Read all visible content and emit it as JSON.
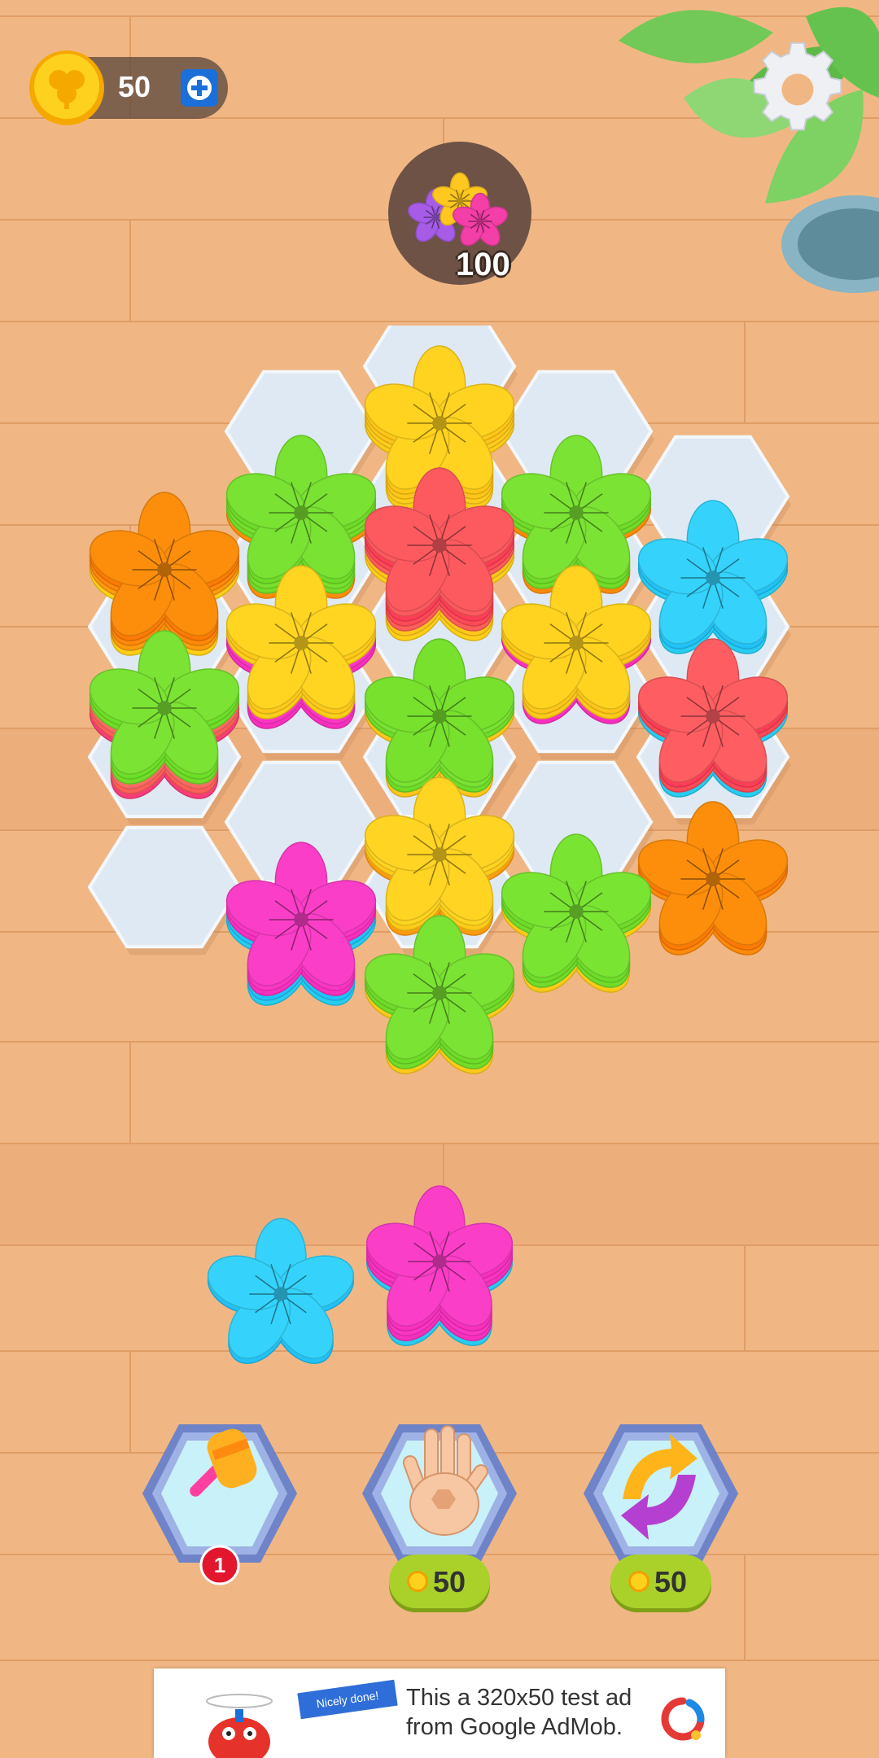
{
  "currency": {
    "coins": "50",
    "add_icon": "plus-icon",
    "coin_icon": "clover-coin-icon"
  },
  "settings": {
    "icon": "gear-icon"
  },
  "goal": {
    "count": "100",
    "icon": "flower-bundle-icon"
  },
  "board": {
    "empty_cells": [
      "1-2",
      "2-2",
      "0-3",
      "3-2"
    ],
    "stacks": [
      {
        "cell": "0-1",
        "layers": [
          "#fed019",
          "#fe9c0e",
          "#fe8a0a",
          "#fd7a05"
        ],
        "top": "#fd8e0b"
      },
      {
        "cell": "0-2",
        "layers": [
          "#fa3d7a",
          "#fe5f59",
          "#fd6a63",
          "#71dd2a",
          "#6ce027"
        ],
        "top": "#7be333"
      },
      {
        "cell": "1-0",
        "layers": [
          "#fecb19",
          "#fdcd1c",
          "#fec61a",
          "#ffc618"
        ],
        "top": "#ffd31f"
      },
      {
        "cell": "1-1",
        "layers": [
          "#fd8e0b",
          "#71dd2a",
          "#76e02d",
          "#6ddb27"
        ],
        "top": "#79e232"
      },
      {
        "cell": "1-1b",
        "layers": [
          "#f92fbf",
          "#fb35c4",
          "#fed019",
          "#fec91a"
        ],
        "top": "#ffd521"
      },
      {
        "cell": "1-3",
        "layers": [
          "#27cdf0",
          "#fe3d56",
          "#fe5960",
          "#fd4a57"
        ],
        "top": "#fe5e62"
      },
      {
        "cell": "2-0",
        "layers": [
          "#fed019",
          "#fec61a",
          "#fe5f59",
          "#fd4a57",
          "#fe3d56",
          "#fd5a5e"
        ],
        "top": "#fd5a60"
      },
      {
        "cell": "2-1",
        "layers": [
          "#fec61a",
          "#6edc28",
          "#79e232"
        ],
        "top": "#77e12e"
      },
      {
        "cell": "2-2",
        "layers": [
          "#fe9c0e",
          "#fecb19",
          "#fed521"
        ],
        "top": "#ffd423"
      },
      {
        "cell": "2-3",
        "layers": [
          "#fecb19",
          "#71dd2a",
          "#6edc28"
        ],
        "top": "#7ae433"
      },
      {
        "cell": "3-0",
        "layers": [
          "#fe8a0a",
          "#71dd2a",
          "#6edc28"
        ],
        "top": "#7be333"
      },
      {
        "cell": "3-1",
        "layers": [
          "#f92fbf",
          "#fecb19",
          "#fec61a"
        ],
        "top": "#ffd31f"
      },
      {
        "cell": "3-2",
        "layers": [
          "#fecb19",
          "#71dd2a",
          "#6edc28"
        ],
        "top": "#7be333"
      },
      {
        "cell": "4-0",
        "layers": [
          "#27cdf0",
          "#21c2f7"
        ],
        "top": "#35d3fb"
      },
      {
        "cell": "4-1",
        "layers": [
          "#27cdf0",
          "#fd4a57",
          "#fe3d56"
        ],
        "top": "#fe5e62"
      },
      {
        "cell": "4-2",
        "layers": [
          "#fe8a0a",
          "#fd7a05"
        ],
        "top": "#fd8e0b"
      }
    ]
  },
  "tray": [
    {
      "layers": [
        "#21c2f7"
      ],
      "top": "#35d3fb"
    },
    {
      "layers": [
        "#27cdf0",
        "#f92fbf",
        "#fb35c4",
        "#f92fbf"
      ],
      "top": "#fb3ec8"
    }
  ],
  "boosters": [
    {
      "name": "hammer",
      "icon": "hammer-icon",
      "badge": "1",
      "price": null
    },
    {
      "name": "hand",
      "icon": "hand-icon",
      "badge": null,
      "price": "50"
    },
    {
      "name": "shuffle",
      "icon": "shuffle-icon",
      "badge": null,
      "price": "50"
    }
  ],
  "ad": {
    "text": "This a 320x50 test ad from Google AdMob.",
    "flag": "Nicely done!"
  },
  "colors": {
    "wood": "#f0b784",
    "wood_dark": "#e4a772",
    "hex_tile": "#dfe9f4",
    "booster_frame": "#8da0d8",
    "price_pill": "#a9d12a"
  }
}
